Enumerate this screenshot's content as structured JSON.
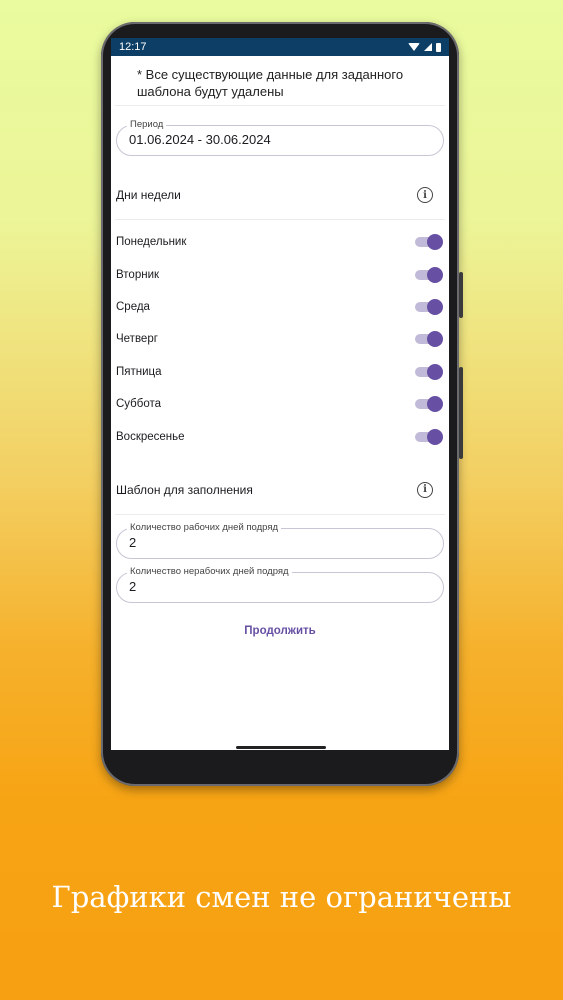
{
  "status": {
    "time": "12:17"
  },
  "warning_text": "* Все существующие данные для заданного шаблона будут удалены",
  "period": {
    "label": "Период",
    "value": "01.06.2024 - 30.06.2024"
  },
  "weekdays": {
    "title": "Дни недели",
    "items": [
      {
        "label": "Понедельник",
        "enabled": true
      },
      {
        "label": "Вторник",
        "enabled": true
      },
      {
        "label": "Среда",
        "enabled": true
      },
      {
        "label": "Четверг",
        "enabled": true
      },
      {
        "label": "Пятница",
        "enabled": true
      },
      {
        "label": "Суббота",
        "enabled": true
      },
      {
        "label": "Воскресенье",
        "enabled": true
      }
    ]
  },
  "template": {
    "title": "Шаблон для заполнения",
    "work_days": {
      "label": "Количество рабочих дней подряд",
      "value": "2"
    },
    "off_days": {
      "label": "Количество нерабочих дней подряд",
      "value": "2"
    }
  },
  "continue_label": "Продолжить",
  "caption": "Графики смен не ограничены",
  "colors": {
    "accent": "#6750a4",
    "status_bar": "#0d3f66"
  },
  "icons": {
    "info": "info-icon",
    "wifi": "wifi-icon",
    "signal": "signal-icon",
    "battery": "battery-icon"
  }
}
